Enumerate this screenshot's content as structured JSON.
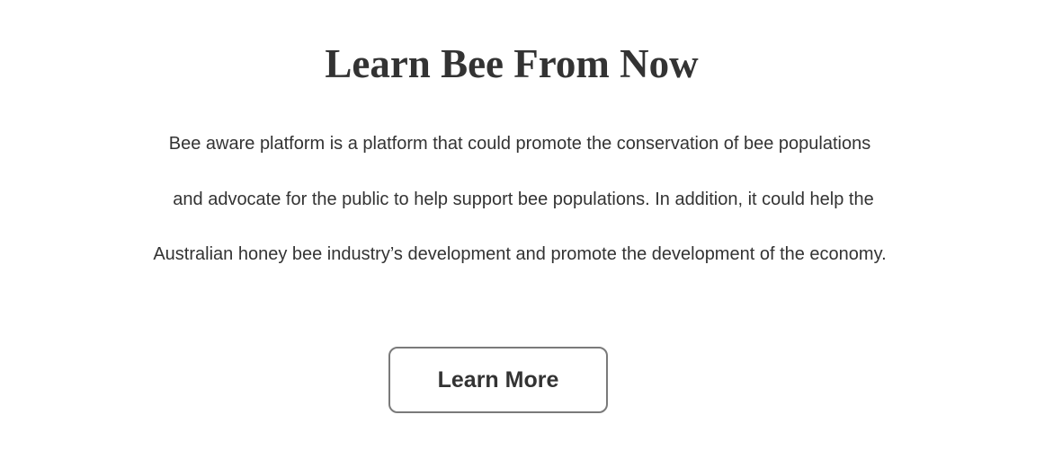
{
  "section": {
    "title": "Learn Bee From Now",
    "description_lines": [
      "Bee aware platform is a platform that could promote the conservation of bee populations",
      "and advocate for the public to help support bee populations. In addition, it could help the",
      "Australian honey bee industry’s development and promote the development of the economy."
    ],
    "button_label": "Learn More"
  },
  "colors": {
    "text": "#333333",
    "button_border": "#7a7a7a",
    "background": "#ffffff"
  }
}
